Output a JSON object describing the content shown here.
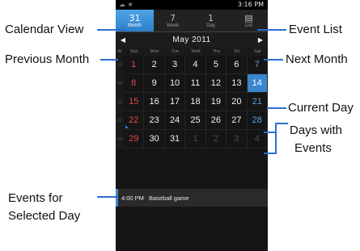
{
  "status_bar": {
    "time": "3:16 PM",
    "left_icons": "☁ ★"
  },
  "tabs": [
    {
      "icon": "31",
      "label": "Month",
      "active": true
    },
    {
      "icon": "7",
      "label": "Week",
      "active": false
    },
    {
      "icon": "1",
      "label": "Day",
      "active": false
    },
    {
      "icon": "▤",
      "label": "List",
      "active": false
    }
  ],
  "month_title": "May  2011",
  "day_headers": [
    "W",
    "Sun",
    "Mon",
    "Tue",
    "Wed",
    "Thu",
    "Fri",
    "Sat"
  ],
  "weeks": [
    {
      "wk": "19",
      "days": [
        "1",
        "2",
        "3",
        "4",
        "5",
        "6",
        "7"
      ]
    },
    {
      "wk": "20",
      "days": [
        "8",
        "9",
        "10",
        "11",
        "12",
        "13",
        "14"
      ]
    },
    {
      "wk": "21",
      "days": [
        "15",
        "16",
        "17",
        "18",
        "19",
        "20",
        "21"
      ]
    },
    {
      "wk": "22",
      "days": [
        "22",
        "23",
        "24",
        "25",
        "26",
        "27",
        "28"
      ]
    },
    {
      "wk": "23",
      "days": [
        "29",
        "30",
        "31",
        "1",
        "2",
        "3",
        "4"
      ]
    }
  ],
  "event": {
    "time": "4:00 PM",
    "title": "Baseball game"
  },
  "callouts": {
    "calendar_view": "Calendar View",
    "previous_month": "Previous Month",
    "event_list": "Event List",
    "next_month": "Next Month",
    "current_day": "Current Day",
    "days_with_events_1": "Days with",
    "days_with_events_2": "Events",
    "events_selected_1": "Events for",
    "events_selected_2": "Selected Day"
  }
}
